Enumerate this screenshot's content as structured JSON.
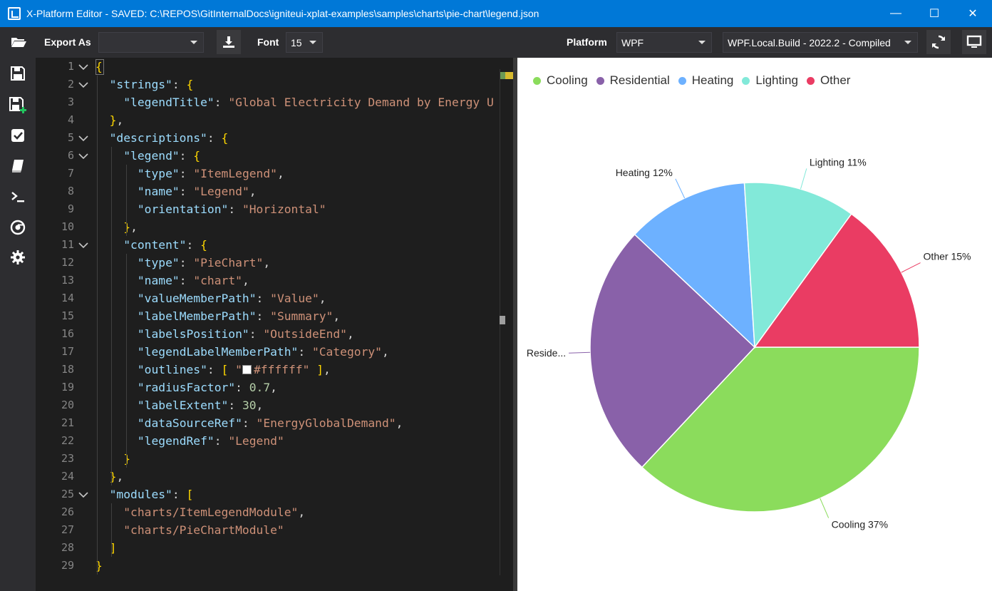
{
  "window": {
    "title": "X-Platform Editor - SAVED: C:\\REPOS\\GitInternalDocs\\igniteui-xplat-examples\\samples\\charts\\pie-chart\\legend.json",
    "minimize_glyph": "—",
    "maximize_glyph": "☐",
    "close_glyph": "✕"
  },
  "toolbar": {
    "export_label": "Export As",
    "export_value": "",
    "font_label": "Font",
    "font_value": "15",
    "platform_label": "Platform",
    "platform_value": "WPF",
    "build_value": "WPF.Local.Build - 2022.2 - Compiled"
  },
  "sidebar": {
    "icons": [
      "open-folder-icon",
      "save-icon",
      "save-as-icon",
      "checkbox-icon",
      "book-icon",
      "terminal-icon",
      "chrome-icon",
      "settings-gear-icon"
    ]
  },
  "editor": {
    "line_numbers": [
      "1",
      "2",
      "3",
      "4",
      "5",
      "6",
      "7",
      "8",
      "9",
      "10",
      "11",
      "12",
      "13",
      "14",
      "15",
      "16",
      "17",
      "18",
      "19",
      "20",
      "21",
      "22",
      "23",
      "24",
      "25",
      "26",
      "27",
      "28",
      "29"
    ],
    "folds": [
      1,
      2,
      5,
      6,
      11,
      25
    ],
    "lines": [
      "{",
      "  \"strings\": {",
      "    \"legendTitle\": \"Global Electricity Demand by Energy U",
      "  },",
      "  \"descriptions\": {",
      "    \"legend\": {",
      "      \"type\": \"ItemLegend\",",
      "      \"name\": \"Legend\",",
      "      \"orientation\": \"Horizontal\"",
      "    },",
      "    \"content\": {",
      "      \"type\": \"PieChart\",",
      "      \"name\": \"chart\",",
      "      \"valueMemberPath\": \"Value\",",
      "      \"labelMemberPath\": \"Summary\",",
      "      \"labelsPosition\": \"OutsideEnd\",",
      "      \"legendLabelMemberPath\": \"Category\",",
      "      \"outlines\": [ \"#ffffff\" ],",
      "      \"radiusFactor\": 0.7,",
      "      \"labelExtent\": 30,",
      "      \"dataSourceRef\": \"EnergyGlobalDemand\",",
      "      \"legendRef\": \"Legend\"",
      "    }",
      "  },",
      "  \"modules\": [",
      "    \"charts/ItemLegendModule\",",
      "    \"charts/PieChartModule\"",
      "  ]",
      "}"
    ]
  },
  "chart_data": {
    "type": "pie",
    "legend": [
      "Cooling",
      "Residential",
      "Heating",
      "Lighting",
      "Other"
    ],
    "legend_placement": "top-left",
    "categories": [
      "Cooling",
      "Residential",
      "Heating",
      "Lighting",
      "Other"
    ],
    "values": [
      37,
      25,
      12,
      11,
      15
    ],
    "labels": [
      "Cooling 37%",
      "Reside...",
      "Heating 12%",
      "Lighting 11%",
      "Other 15%"
    ],
    "colors": [
      "#8bdc5c",
      "#8961a9",
      "#6db1ff",
      "#82e9d9",
      "#ea3c63"
    ],
    "outline_color": "#ffffff",
    "start_angle_deg": 0,
    "direction": "clockwise"
  }
}
